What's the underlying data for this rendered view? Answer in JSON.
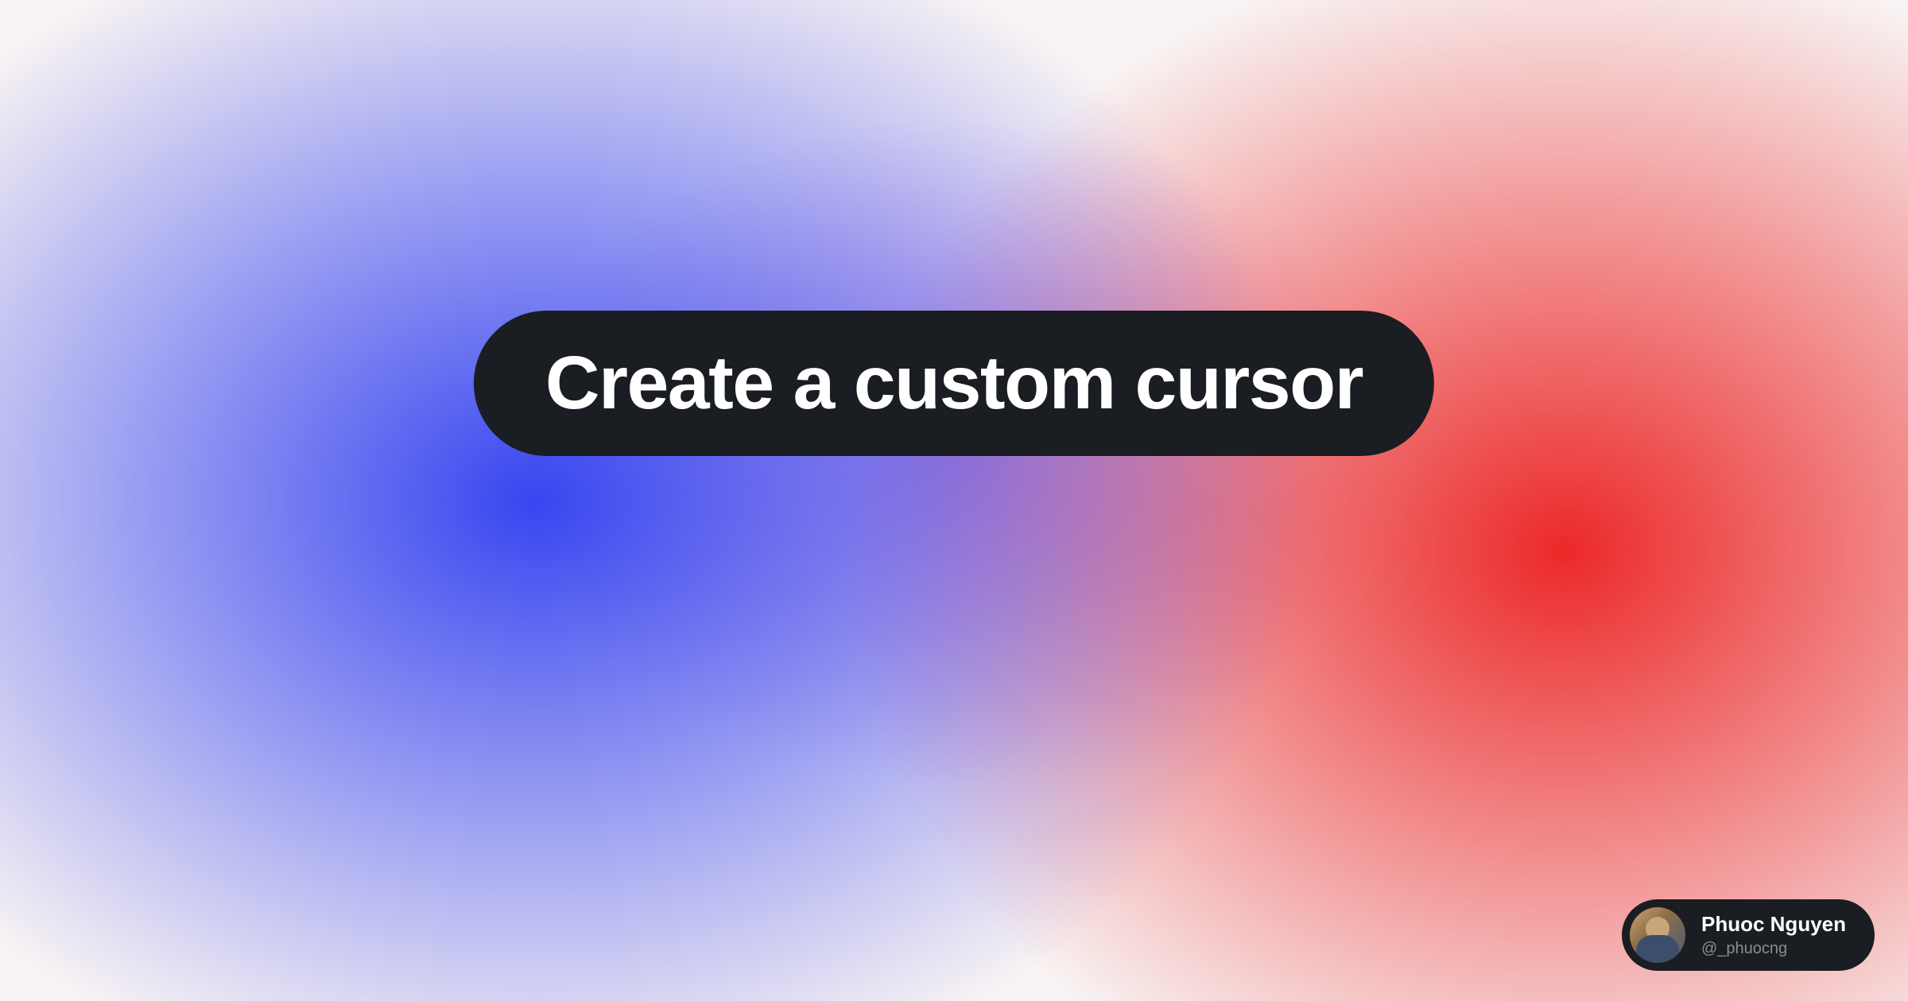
{
  "title": "Create a custom cursor",
  "author": {
    "name": "Phuoc Nguyen",
    "handle": "@_phuocng"
  }
}
